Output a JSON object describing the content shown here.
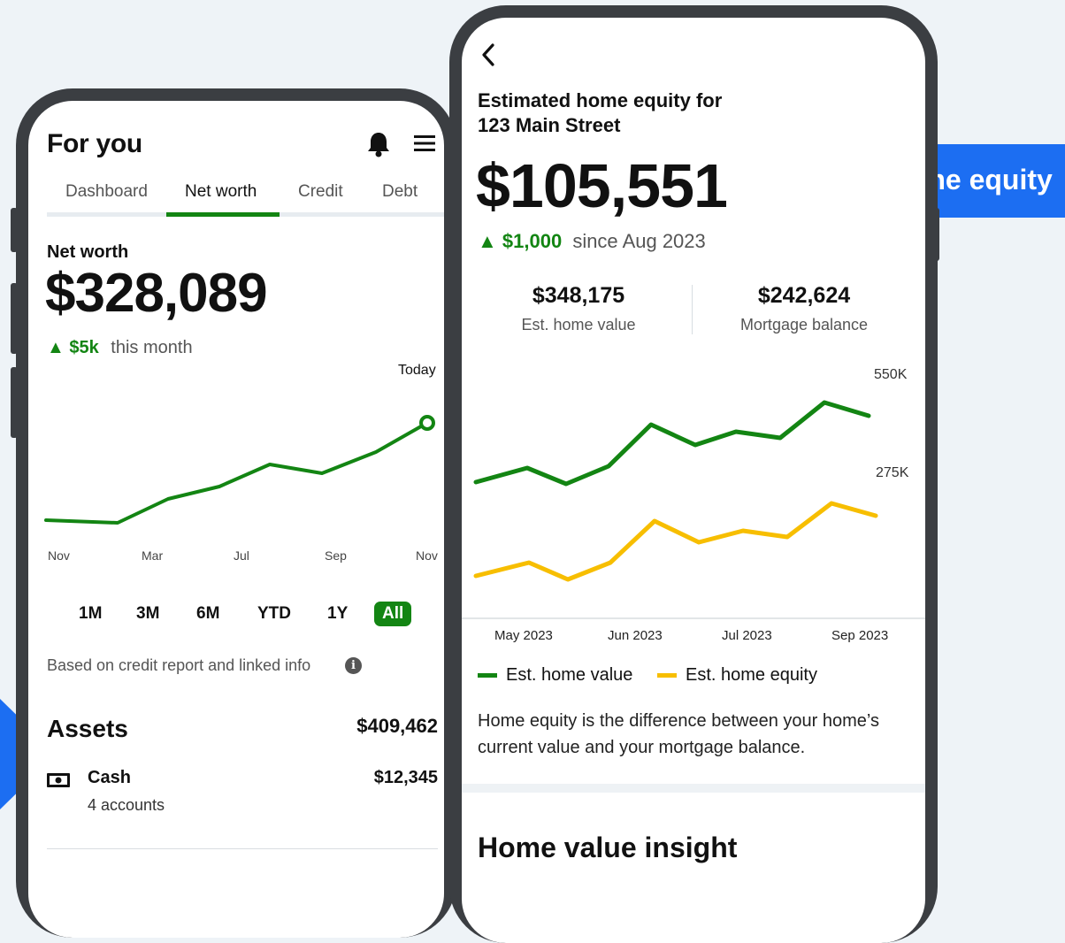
{
  "left_phone": {
    "title": "For you",
    "tabs": [
      {
        "label": "Dashboard",
        "active": false
      },
      {
        "label": "Net worth",
        "active": true
      },
      {
        "label": "Credit",
        "active": false
      },
      {
        "label": "Debt",
        "active": false
      }
    ],
    "net_worth": {
      "label": "Net worth",
      "value": "$328,089",
      "change": "▲ $5k",
      "change_period": "this month"
    },
    "chart": {
      "today_label": "Today",
      "x_labels": [
        "Nov",
        "Mar",
        "Jul",
        "Sep",
        "Nov"
      ]
    },
    "ranges": [
      {
        "label": "1M",
        "active": false
      },
      {
        "label": "3M",
        "active": false
      },
      {
        "label": "6M",
        "active": false
      },
      {
        "label": "YTD",
        "active": false
      },
      {
        "label": "1Y",
        "active": false
      },
      {
        "label": "All",
        "active": true
      }
    ],
    "note": "Based on credit report and linked info",
    "info_icon": "i",
    "assets": {
      "heading": "Assets",
      "total": "$409,462",
      "items": [
        {
          "icon": "cash-icon",
          "name": "Cash",
          "sub": "4 accounts",
          "value": "$12,345"
        }
      ]
    }
  },
  "right_phone": {
    "back_icon": "‹",
    "title_line1": "Estimated home equity for",
    "title_line2": "123 Main Street",
    "equity_value": "$105,551",
    "change": "▲ $1,000",
    "change_period": "since Aug 2023",
    "stats": [
      {
        "value": "$348,175",
        "label": "Est. home value"
      },
      {
        "value": "$242,624",
        "label": "Mortgage balance"
      }
    ],
    "y_labels": [
      "550K",
      "275K"
    ],
    "x_labels": [
      "May 2023",
      "Jun 2023",
      "Jul 2023",
      "Sep 2023"
    ],
    "legend": [
      {
        "label": "Est. home value",
        "color": "#138513"
      },
      {
        "label": "Est. home equity",
        "color": "#F7BE00"
      }
    ],
    "description": "Home equity is the difference between your home’s current value and your mortgage balance.",
    "insight_heading": "Home value insight"
  },
  "callout": {
    "text": "... and home equity"
  },
  "colors": {
    "accent_green": "#138513",
    "accent_yellow": "#F7BE00",
    "callout_blue": "#1C6EF2"
  }
}
